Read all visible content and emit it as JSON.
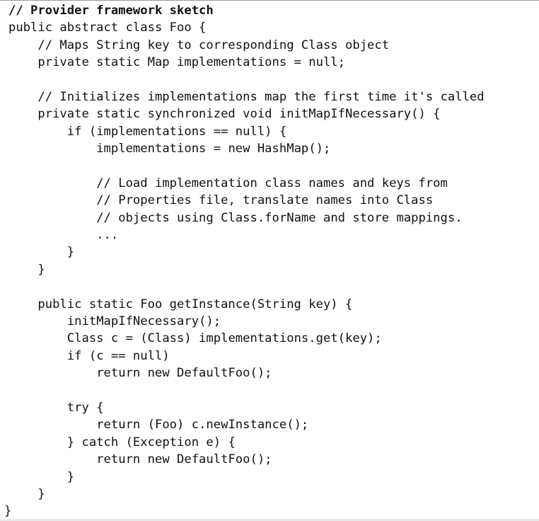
{
  "code_listing": {
    "lines": [
      {
        "indent": 1,
        "text": "// Provider framework sketch",
        "bold": true
      },
      {
        "indent": 1,
        "text": "public abstract class Foo {"
      },
      {
        "indent": 5,
        "text": "// Maps String key to corresponding Class object"
      },
      {
        "indent": 5,
        "text": "private static Map implementations = null;"
      },
      {
        "indent": 0,
        "text": ""
      },
      {
        "indent": 5,
        "text": "// Initializes implementations map the first time it's called"
      },
      {
        "indent": 5,
        "text": "private static synchronized void initMapIfNecessary() {"
      },
      {
        "indent": 9,
        "text": "if (implementations == null) {"
      },
      {
        "indent": 13,
        "text": "implementations = new HashMap();"
      },
      {
        "indent": 0,
        "text": ""
      },
      {
        "indent": 13,
        "text": "// Load implementation class names and keys from"
      },
      {
        "indent": 13,
        "text": "// Properties file, translate names into Class"
      },
      {
        "indent": 13,
        "text": "// objects using Class.forName and store mappings."
      },
      {
        "indent": 13,
        "text": "..."
      },
      {
        "indent": 9,
        "text": "}"
      },
      {
        "indent": 5,
        "text": "}"
      },
      {
        "indent": 0,
        "text": ""
      },
      {
        "indent": 5,
        "text": "public static Foo getInstance(String key) {"
      },
      {
        "indent": 9,
        "text": "initMapIfNecessary();"
      },
      {
        "indent": 9,
        "text": "Class c = (Class) implementations.get(key);"
      },
      {
        "indent": 9,
        "text": "if (c == null)"
      },
      {
        "indent": 13,
        "text": "return new DefaultFoo();"
      },
      {
        "indent": 0,
        "text": ""
      },
      {
        "indent": 9,
        "text": "try {"
      },
      {
        "indent": 13,
        "text": "return (Foo) c.newInstance();"
      },
      {
        "indent": 9,
        "text": "} catch (Exception e) {"
      },
      {
        "indent": 13,
        "text": "return new DefaultFoo();"
      },
      {
        "indent": 9,
        "text": "}"
      },
      {
        "indent": 5,
        "text": "}"
      },
      {
        "indent": 0,
        "text": "}"
      }
    ]
  }
}
